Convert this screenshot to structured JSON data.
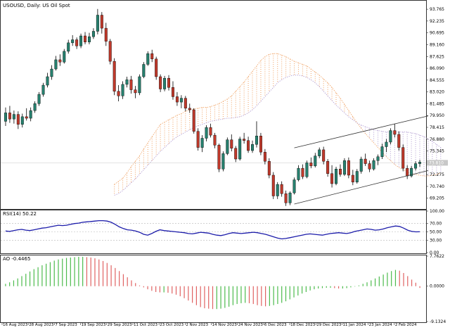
{
  "header": {
    "main_title": "USOUSD, Daily:  US Oil Spot",
    "rsi_title": "RSI(14) 50.22",
    "ao_title": "AO -0.4465"
  },
  "colors": {
    "bull": "#26806e",
    "bear": "#c0392b",
    "cloud_a": "#f0a060",
    "cloud_b": "#b09ad0",
    "rsi": "#1c1caa",
    "ao_up": "#4cbb4c",
    "ao_down": "#e06262",
    "axis": "#333333",
    "channel": "#333333"
  },
  "chart_data": [
    {
      "type": "candlestick",
      "name": "price",
      "y_ticks": [
        "93.765",
        "92.235",
        "90.695",
        "89.160",
        "87.625",
        "86.090",
        "84.555",
        "83.020",
        "81.485",
        "79.950",
        "78.415",
        "76.880",
        "75.345",
        "73.810",
        "72.275",
        "70.740",
        "69.205"
      ],
      "ylim": [
        67.9,
        94.6
      ],
      "current_price": "73.810",
      "x_ticks": [
        "16 Aug 2023",
        "28 Aug 2023",
        "7 Sep 2023",
        "19 Sep 2023",
        "29 Sep 2023",
        "11 Oct 2023",
        "23 Oct 2023",
        "2 Nov 2023",
        "14 Nov 2023",
        "24 Nov 2023",
        "6 Dec 2023",
        "18 Dec 2023",
        "29 Dec 2023",
        "11 Jan 2024",
        "23 Jan 2024",
        "2 Feb 2024"
      ],
      "candles": [
        {
          "o": 79.2,
          "h": 81.0,
          "l": 78.6,
          "c": 80.3
        },
        {
          "o": 80.3,
          "h": 81.2,
          "l": 79.0,
          "c": 79.5
        },
        {
          "o": 79.5,
          "h": 80.6,
          "l": 78.9,
          "c": 80.1
        },
        {
          "o": 80.1,
          "h": 80.5,
          "l": 78.2,
          "c": 78.8
        },
        {
          "o": 78.8,
          "h": 80.2,
          "l": 78.4,
          "c": 79.8
        },
        {
          "o": 79.8,
          "h": 80.9,
          "l": 79.3,
          "c": 79.6
        },
        {
          "o": 79.6,
          "h": 81.0,
          "l": 79.2,
          "c": 80.6
        },
        {
          "o": 80.6,
          "h": 81.8,
          "l": 80.3,
          "c": 81.5
        },
        {
          "o": 81.5,
          "h": 83.0,
          "l": 81.2,
          "c": 82.7
        },
        {
          "o": 82.7,
          "h": 84.2,
          "l": 82.4,
          "c": 83.9
        },
        {
          "o": 83.9,
          "h": 85.5,
          "l": 83.6,
          "c": 85.0
        },
        {
          "o": 85.0,
          "h": 86.5,
          "l": 84.6,
          "c": 86.0
        },
        {
          "o": 86.0,
          "h": 87.7,
          "l": 85.8,
          "c": 87.2
        },
        {
          "o": 87.2,
          "h": 87.9,
          "l": 86.4,
          "c": 86.9
        },
        {
          "o": 86.9,
          "h": 88.6,
          "l": 86.7,
          "c": 88.3
        },
        {
          "o": 88.3,
          "h": 89.8,
          "l": 88.0,
          "c": 89.4
        },
        {
          "o": 89.4,
          "h": 90.4,
          "l": 89.0,
          "c": 89.8
        },
        {
          "o": 89.8,
          "h": 90.1,
          "l": 88.6,
          "c": 89.0
        },
        {
          "o": 89.0,
          "h": 90.6,
          "l": 88.7,
          "c": 90.3
        },
        {
          "o": 90.3,
          "h": 90.8,
          "l": 89.2,
          "c": 89.5
        },
        {
          "o": 89.5,
          "h": 90.7,
          "l": 89.2,
          "c": 90.2
        },
        {
          "o": 90.2,
          "h": 91.3,
          "l": 89.9,
          "c": 90.9
        },
        {
          "o": 90.9,
          "h": 93.8,
          "l": 90.5,
          "c": 93.0
        },
        {
          "o": 93.0,
          "h": 93.4,
          "l": 90.6,
          "c": 91.3
        },
        {
          "o": 91.3,
          "h": 92.0,
          "l": 89.0,
          "c": 89.6
        },
        {
          "o": 89.6,
          "h": 89.9,
          "l": 86.6,
          "c": 87.0
        },
        {
          "o": 87.0,
          "h": 87.4,
          "l": 82.6,
          "c": 83.1
        },
        {
          "o": 83.1,
          "h": 83.9,
          "l": 81.8,
          "c": 82.5
        },
        {
          "o": 82.5,
          "h": 84.4,
          "l": 82.1,
          "c": 84.0
        },
        {
          "o": 84.0,
          "h": 85.0,
          "l": 83.6,
          "c": 84.6
        },
        {
          "o": 84.6,
          "h": 85.1,
          "l": 82.8,
          "c": 83.3
        },
        {
          "o": 83.3,
          "h": 83.8,
          "l": 82.2,
          "c": 82.9
        },
        {
          "o": 82.9,
          "h": 85.3,
          "l": 82.6,
          "c": 85.0
        },
        {
          "o": 85.0,
          "h": 86.9,
          "l": 84.8,
          "c": 86.6
        },
        {
          "o": 86.6,
          "h": 88.3,
          "l": 86.4,
          "c": 88.0
        },
        {
          "o": 88.0,
          "h": 88.5,
          "l": 86.9,
          "c": 87.3
        },
        {
          "o": 87.3,
          "h": 87.6,
          "l": 84.6,
          "c": 85.0
        },
        {
          "o": 85.0,
          "h": 85.3,
          "l": 83.0,
          "c": 83.4
        },
        {
          "o": 83.4,
          "h": 85.1,
          "l": 83.1,
          "c": 84.8
        },
        {
          "o": 84.8,
          "h": 85.2,
          "l": 83.2,
          "c": 83.6
        },
        {
          "o": 83.6,
          "h": 84.4,
          "l": 82.0,
          "c": 82.4
        },
        {
          "o": 82.4,
          "h": 83.0,
          "l": 81.2,
          "c": 81.7
        },
        {
          "o": 81.7,
          "h": 82.6,
          "l": 80.9,
          "c": 82.2
        },
        {
          "o": 82.2,
          "h": 82.5,
          "l": 80.5,
          "c": 80.9
        },
        {
          "o": 80.9,
          "h": 81.5,
          "l": 80.3,
          "c": 80.7
        },
        {
          "o": 80.7,
          "h": 80.9,
          "l": 77.6,
          "c": 77.9
        },
        {
          "o": 77.9,
          "h": 78.3,
          "l": 75.4,
          "c": 75.8
        },
        {
          "o": 75.8,
          "h": 77.4,
          "l": 75.2,
          "c": 77.0
        },
        {
          "o": 77.0,
          "h": 78.7,
          "l": 76.6,
          "c": 78.4
        },
        {
          "o": 78.4,
          "h": 78.9,
          "l": 77.1,
          "c": 77.4
        },
        {
          "o": 77.4,
          "h": 77.7,
          "l": 75.7,
          "c": 76.1
        },
        {
          "o": 76.1,
          "h": 76.3,
          "l": 72.6,
          "c": 73.0
        },
        {
          "o": 73.0,
          "h": 75.3,
          "l": 72.7,
          "c": 75.0
        },
        {
          "o": 75.0,
          "h": 77.1,
          "l": 74.8,
          "c": 76.8
        },
        {
          "o": 76.8,
          "h": 77.5,
          "l": 75.3,
          "c": 75.7
        },
        {
          "o": 75.7,
          "h": 76.0,
          "l": 73.9,
          "c": 74.3
        },
        {
          "o": 74.3,
          "h": 77.2,
          "l": 74.1,
          "c": 76.9
        },
        {
          "o": 76.9,
          "h": 77.7,
          "l": 76.3,
          "c": 76.7
        },
        {
          "o": 76.7,
          "h": 77.2,
          "l": 75.1,
          "c": 75.4
        },
        {
          "o": 75.4,
          "h": 76.7,
          "l": 75.1,
          "c": 76.2
        },
        {
          "o": 76.2,
          "h": 79.2,
          "l": 75.8,
          "c": 77.3
        },
        {
          "o": 77.3,
          "h": 77.7,
          "l": 74.8,
          "c": 75.2
        },
        {
          "o": 75.2,
          "h": 75.6,
          "l": 73.6,
          "c": 74.0
        },
        {
          "o": 74.0,
          "h": 74.4,
          "l": 71.8,
          "c": 72.2
        },
        {
          "o": 72.2,
          "h": 72.6,
          "l": 69.1,
          "c": 69.5
        },
        {
          "o": 69.5,
          "h": 71.3,
          "l": 69.1,
          "c": 71.0
        },
        {
          "o": 71.0,
          "h": 71.4,
          "l": 69.4,
          "c": 69.8
        },
        {
          "o": 69.8,
          "h": 70.2,
          "l": 68.2,
          "c": 68.6
        },
        {
          "o": 68.6,
          "h": 70.1,
          "l": 68.3,
          "c": 69.9
        },
        {
          "o": 69.9,
          "h": 71.9,
          "l": 69.7,
          "c": 71.6
        },
        {
          "o": 71.6,
          "h": 73.5,
          "l": 71.4,
          "c": 73.1
        },
        {
          "o": 73.1,
          "h": 73.6,
          "l": 71.7,
          "c": 72.0
        },
        {
          "o": 72.0,
          "h": 74.1,
          "l": 71.8,
          "c": 73.8
        },
        {
          "o": 73.8,
          "h": 74.5,
          "l": 73.1,
          "c": 73.4
        },
        {
          "o": 73.4,
          "h": 75.1,
          "l": 73.2,
          "c": 74.7
        },
        {
          "o": 74.7,
          "h": 75.8,
          "l": 74.4,
          "c": 75.5
        },
        {
          "o": 75.5,
          "h": 75.9,
          "l": 73.6,
          "c": 74.0
        },
        {
          "o": 74.0,
          "h": 74.3,
          "l": 72.0,
          "c": 72.4
        },
        {
          "o": 72.4,
          "h": 73.5,
          "l": 70.6,
          "c": 71.1
        },
        {
          "o": 71.1,
          "h": 73.3,
          "l": 70.9,
          "c": 73.0
        },
        {
          "o": 73.0,
          "h": 73.6,
          "l": 72.0,
          "c": 72.3
        },
        {
          "o": 72.3,
          "h": 74.4,
          "l": 72.1,
          "c": 74.1
        },
        {
          "o": 74.1,
          "h": 74.5,
          "l": 71.8,
          "c": 72.2
        },
        {
          "o": 72.2,
          "h": 72.9,
          "l": 70.9,
          "c": 71.3
        },
        {
          "o": 71.3,
          "h": 73.0,
          "l": 71.1,
          "c": 72.7
        },
        {
          "o": 72.7,
          "h": 74.6,
          "l": 72.4,
          "c": 74.3
        },
        {
          "o": 74.3,
          "h": 75.0,
          "l": 73.4,
          "c": 73.7
        },
        {
          "o": 73.7,
          "h": 74.1,
          "l": 72.6,
          "c": 73.0
        },
        {
          "o": 73.0,
          "h": 74.4,
          "l": 72.8,
          "c": 74.1
        },
        {
          "o": 74.1,
          "h": 74.9,
          "l": 73.5,
          "c": 74.6
        },
        {
          "o": 74.6,
          "h": 76.3,
          "l": 74.3,
          "c": 75.9
        },
        {
          "o": 75.9,
          "h": 76.9,
          "l": 75.2,
          "c": 76.5
        },
        {
          "o": 76.5,
          "h": 78.3,
          "l": 76.2,
          "c": 78.0
        },
        {
          "o": 78.0,
          "h": 78.9,
          "l": 77.1,
          "c": 77.5
        },
        {
          "o": 77.5,
          "h": 77.9,
          "l": 75.4,
          "c": 75.8
        },
        {
          "o": 75.8,
          "h": 76.2,
          "l": 72.7,
          "c": 73.1
        },
        {
          "o": 73.1,
          "h": 73.5,
          "l": 71.7,
          "c": 72.1
        },
        {
          "o": 72.1,
          "h": 73.4,
          "l": 71.9,
          "c": 73.1
        },
        {
          "o": 73.1,
          "h": 74.0,
          "l": 72.8,
          "c": 73.7
        },
        {
          "o": 73.7,
          "h": 74.2,
          "l": 73.3,
          "c": 73.9
        }
      ],
      "ichimoku_span_a": [
        71.0,
        71.4,
        71.8,
        72.5,
        73.3,
        74.0,
        74.7,
        75.6,
        76.4,
        77.2,
        78.0,
        78.8,
        79.1,
        79.4,
        79.7,
        80.0,
        80.2,
        80.5,
        80.7,
        80.8,
        80.9,
        81.0,
        81.0,
        81.1,
        81.3,
        81.5,
        81.8,
        82.1,
        82.5,
        83.1,
        83.7,
        84.3,
        85.0,
        85.7,
        86.4,
        87.1,
        87.6,
        87.9,
        88.0,
        88.0,
        87.8,
        87.6,
        87.3,
        87.0,
        86.8,
        86.6,
        86.4,
        86.0,
        85.6,
        85.2,
        84.7,
        84.2,
        83.6,
        82.9,
        82.2,
        81.4,
        80.6,
        79.8,
        79.0,
        78.3,
        77.6,
        77.0,
        76.4,
        75.8,
        75.2,
        74.6,
        74.1,
        73.6,
        73.2,
        72.9,
        72.6,
        72.4,
        72.3,
        72.2,
        72.1,
        72.1,
        72.2,
        72.3,
        72.5
      ],
      "ichimoku_span_b": [
        69.6,
        69.8,
        70.2,
        70.7,
        71.2,
        71.7,
        72.3,
        72.9,
        73.5,
        74.1,
        74.7,
        75.3,
        75.8,
        76.3,
        76.8,
        77.2,
        77.5,
        77.8,
        78.1,
        78.4,
        78.6,
        78.8,
        79.0,
        79.2,
        79.3,
        79.4,
        79.5,
        79.6,
        79.6,
        79.7,
        79.8,
        80.0,
        80.3,
        80.7,
        81.2,
        81.8,
        82.4,
        83.0,
        83.6,
        84.2,
        84.6,
        84.9,
        85.1,
        85.2,
        85.2,
        85.1,
        84.9,
        84.6,
        84.2,
        83.7,
        83.1,
        82.5,
        81.9,
        81.3,
        80.8,
        80.3,
        79.8,
        79.4,
        79.0,
        78.7,
        78.5,
        78.3,
        78.1,
        78.0,
        77.9,
        77.8,
        77.8,
        77.8,
        77.8,
        77.8,
        77.8,
        77.7,
        77.6,
        77.4,
        77.2,
        76.9,
        76.6,
        76.2,
        75.8
      ],
      "channel": {
        "upper": [
          [
            69,
            75.75
          ],
          [
            101,
            79.9
          ]
        ],
        "lower": [
          [
            69,
            68.45
          ],
          [
            101,
            72.8
          ]
        ]
      }
    },
    {
      "type": "line",
      "name": "RSI(14)",
      "y_ticks": [
        "100.00",
        "70.00",
        "50.00",
        "30.00",
        "0.00"
      ],
      "ylim": [
        0,
        100
      ],
      "levels": [
        70,
        50,
        30
      ],
      "values": [
        52,
        51,
        53,
        55,
        56,
        54,
        53,
        55,
        57,
        59,
        60,
        62,
        64,
        66,
        65,
        66,
        68,
        70,
        71,
        73,
        74,
        75,
        76,
        77,
        77,
        76,
        73,
        68,
        62,
        58,
        55,
        54,
        52,
        49,
        44,
        42,
        46,
        51,
        55,
        53,
        52,
        51,
        50,
        49,
        48,
        46,
        45,
        47,
        49,
        48,
        47,
        44,
        42,
        41,
        43,
        46,
        48,
        47,
        46,
        47,
        48,
        49,
        48,
        46,
        44,
        41,
        38,
        35,
        33,
        34,
        36,
        38,
        40,
        42,
        44,
        45,
        44,
        43,
        42,
        44,
        46,
        47,
        48,
        47,
        46,
        48,
        51,
        53,
        55,
        57,
        56,
        54,
        55,
        57,
        60,
        62,
        64,
        63,
        59,
        54,
        51,
        50,
        50.22
      ]
    },
    {
      "type": "bar",
      "name": "AO",
      "y_ticks": [
        "7.7622",
        "0.0000",
        "-9.1324"
      ],
      "ylim": [
        -9.1324,
        7.7622
      ],
      "values": [
        0.6,
        1.0,
        1.5,
        2.0,
        2.6,
        3.2,
        3.8,
        4.4,
        4.9,
        5.4,
        5.8,
        6.2,
        6.6,
        6.9,
        7.1,
        7.3,
        7.4,
        7.5,
        7.6,
        7.6,
        7.5,
        7.4,
        7.2,
        6.9,
        6.5,
        6.0,
        5.4,
        4.7,
        3.9,
        3.1,
        2.3,
        1.5,
        0.8,
        0.2,
        -0.3,
        -0.8,
        -1.2,
        -1.5,
        -1.6,
        -1.6,
        -1.7,
        -1.9,
        -2.2,
        -2.6,
        -3.1,
        -3.7,
        -4.3,
        -4.9,
        -5.4,
        -5.7,
        -5.8,
        -5.9,
        -5.9,
        -5.8,
        -5.6,
        -5.3,
        -4.9,
        -4.6,
        -4.4,
        -4.3,
        -4.4,
        -4.6,
        -4.9,
        -5.1,
        -5.2,
        -5.1,
        -4.9,
        -4.6,
        -4.3,
        -3.9,
        -3.4,
        -2.9,
        -2.4,
        -1.9,
        -1.5,
        -1.1,
        -0.8,
        -0.6,
        -0.5,
        -0.4,
        -0.4,
        -0.5,
        -0.6,
        -0.6,
        -0.5,
        -0.3,
        -0.1,
        0.2,
        0.6,
        1.0,
        1.5,
        2.0,
        2.5,
        3.0,
        3.5,
        3.9,
        4.2,
        4.0,
        3.4,
        2.6,
        1.7,
        0.9,
        -0.4465
      ]
    }
  ]
}
